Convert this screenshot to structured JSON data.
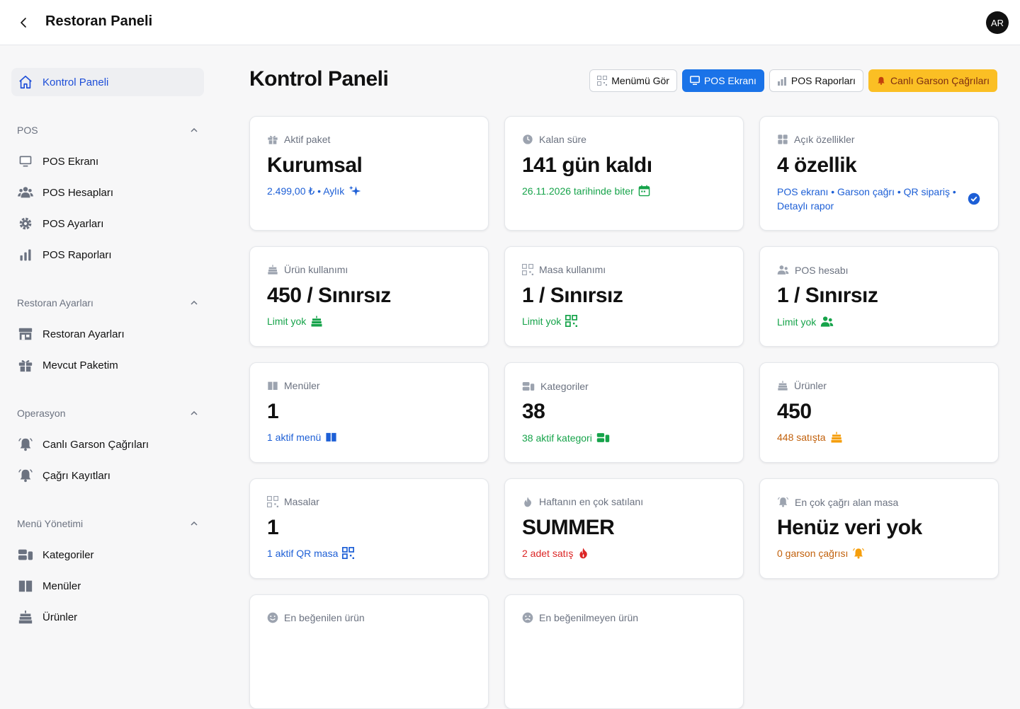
{
  "header": {
    "title": "Restoran Paneli",
    "avatar_initials": "AR"
  },
  "sidebar": {
    "active": {
      "label": "Kontrol Paneli",
      "icon": "home-icon"
    },
    "groups": [
      {
        "title": "POS",
        "items": [
          {
            "label": "POS Ekranı",
            "icon": "monitor-icon"
          },
          {
            "label": "POS Hesapları",
            "icon": "users-icon"
          },
          {
            "label": "POS Ayarları",
            "icon": "gear-icon"
          },
          {
            "label": "POS Raporları",
            "icon": "bar-chart-icon"
          }
        ]
      },
      {
        "title": "Restoran Ayarları",
        "items": [
          {
            "label": "Restoran Ayarları",
            "icon": "store-icon"
          },
          {
            "label": "Mevcut Paketim",
            "icon": "gift-icon"
          }
        ]
      },
      {
        "title": "Operasyon",
        "items": [
          {
            "label": "Canlı Garson Çağrıları",
            "icon": "bell-icon"
          },
          {
            "label": "Çağrı Kayıtları",
            "icon": "bell-icon"
          }
        ]
      },
      {
        "title": "Menü Yönetimi",
        "items": [
          {
            "label": "Kategoriler",
            "icon": "categories-icon"
          },
          {
            "label": "Menüler",
            "icon": "book-icon"
          },
          {
            "label": "Ürünler",
            "icon": "cake-icon"
          }
        ]
      }
    ]
  },
  "main": {
    "title": "Kontrol Paneli",
    "toolbar": {
      "menu": "Menümü Gör",
      "pos": "POS Ekranı",
      "reports": "POS Raporları",
      "calls": "Canlı Garson Çağrıları"
    },
    "cards": [
      {
        "label": "Aktif paket",
        "value": "Kurumsal",
        "sub": "2.499,00 ₺ • Aylık",
        "icon": "gift-icon",
        "sub_icon": "sparkles-icon",
        "color": "#1d5fd6"
      },
      {
        "label": "Kalan süre",
        "value": "141 gün kaldı",
        "sub": "26.11.2026 tarihinde biter",
        "icon": "clock-icon",
        "sub_icon": "calendar-icon",
        "color": "#16a34a"
      },
      {
        "label": "Açık özellikler",
        "value": "4 özellik",
        "sub": "POS ekranı • Garson çağrı • QR sipariş • Detaylı rapor",
        "icon": "grid-icon",
        "sub_icon": "verified-icon",
        "color": "#1d5fd6"
      },
      {
        "label": "Ürün kullanımı",
        "value": "450 / Sınırsız",
        "sub": "Limit yok",
        "icon": "cake-icon",
        "sub_icon": "cake-icon",
        "color": "#16a34a"
      },
      {
        "label": "Masa kullanımı",
        "value": "1 / Sınırsız",
        "sub": "Limit yok",
        "icon": "qr-icon",
        "sub_icon": "qr-icon",
        "color": "#16a34a"
      },
      {
        "label": "POS hesabı",
        "value": "1 / Sınırsız",
        "sub": "Limit yok",
        "icon": "users-icon",
        "sub_icon": "users-icon",
        "color": "#16a34a"
      },
      {
        "label": "Menüler",
        "value": "1",
        "sub": "1 aktif menü",
        "icon": "book-icon",
        "sub_icon": "book-icon",
        "color": "#1d5fd6"
      },
      {
        "label": "Kategoriler",
        "value": "38",
        "sub": "38 aktif kategori",
        "icon": "categories-icon",
        "sub_icon": "categories-icon",
        "color": "#16a34a"
      },
      {
        "label": "Ürünler",
        "value": "450",
        "sub": "448 satışta",
        "icon": "cake-icon",
        "sub_icon": "cake-icon",
        "color": "#c2610c"
      },
      {
        "label": "Masalar",
        "value": "1",
        "sub": "1 aktif QR masa",
        "icon": "qr-icon",
        "sub_icon": "qr-icon",
        "color": "#1d5fd6"
      },
      {
        "label": "Haftanın en çok satılanı",
        "value": "SUMMER",
        "sub": "2 adet satış",
        "icon": "fire-icon",
        "sub_icon": "fire-icon",
        "color": "#dc2626"
      },
      {
        "label": "En çok çağrı alan masa",
        "value": "Henüz veri yok",
        "sub": "0 garson çağrısı",
        "icon": "bell-icon",
        "sub_icon": "bell-icon",
        "color": "#c2610c"
      },
      {
        "label": "En beğenilen ürün",
        "icon": "smile-icon"
      },
      {
        "label": "En beğenilmeyen ürün",
        "icon": "frown-icon"
      }
    ]
  }
}
